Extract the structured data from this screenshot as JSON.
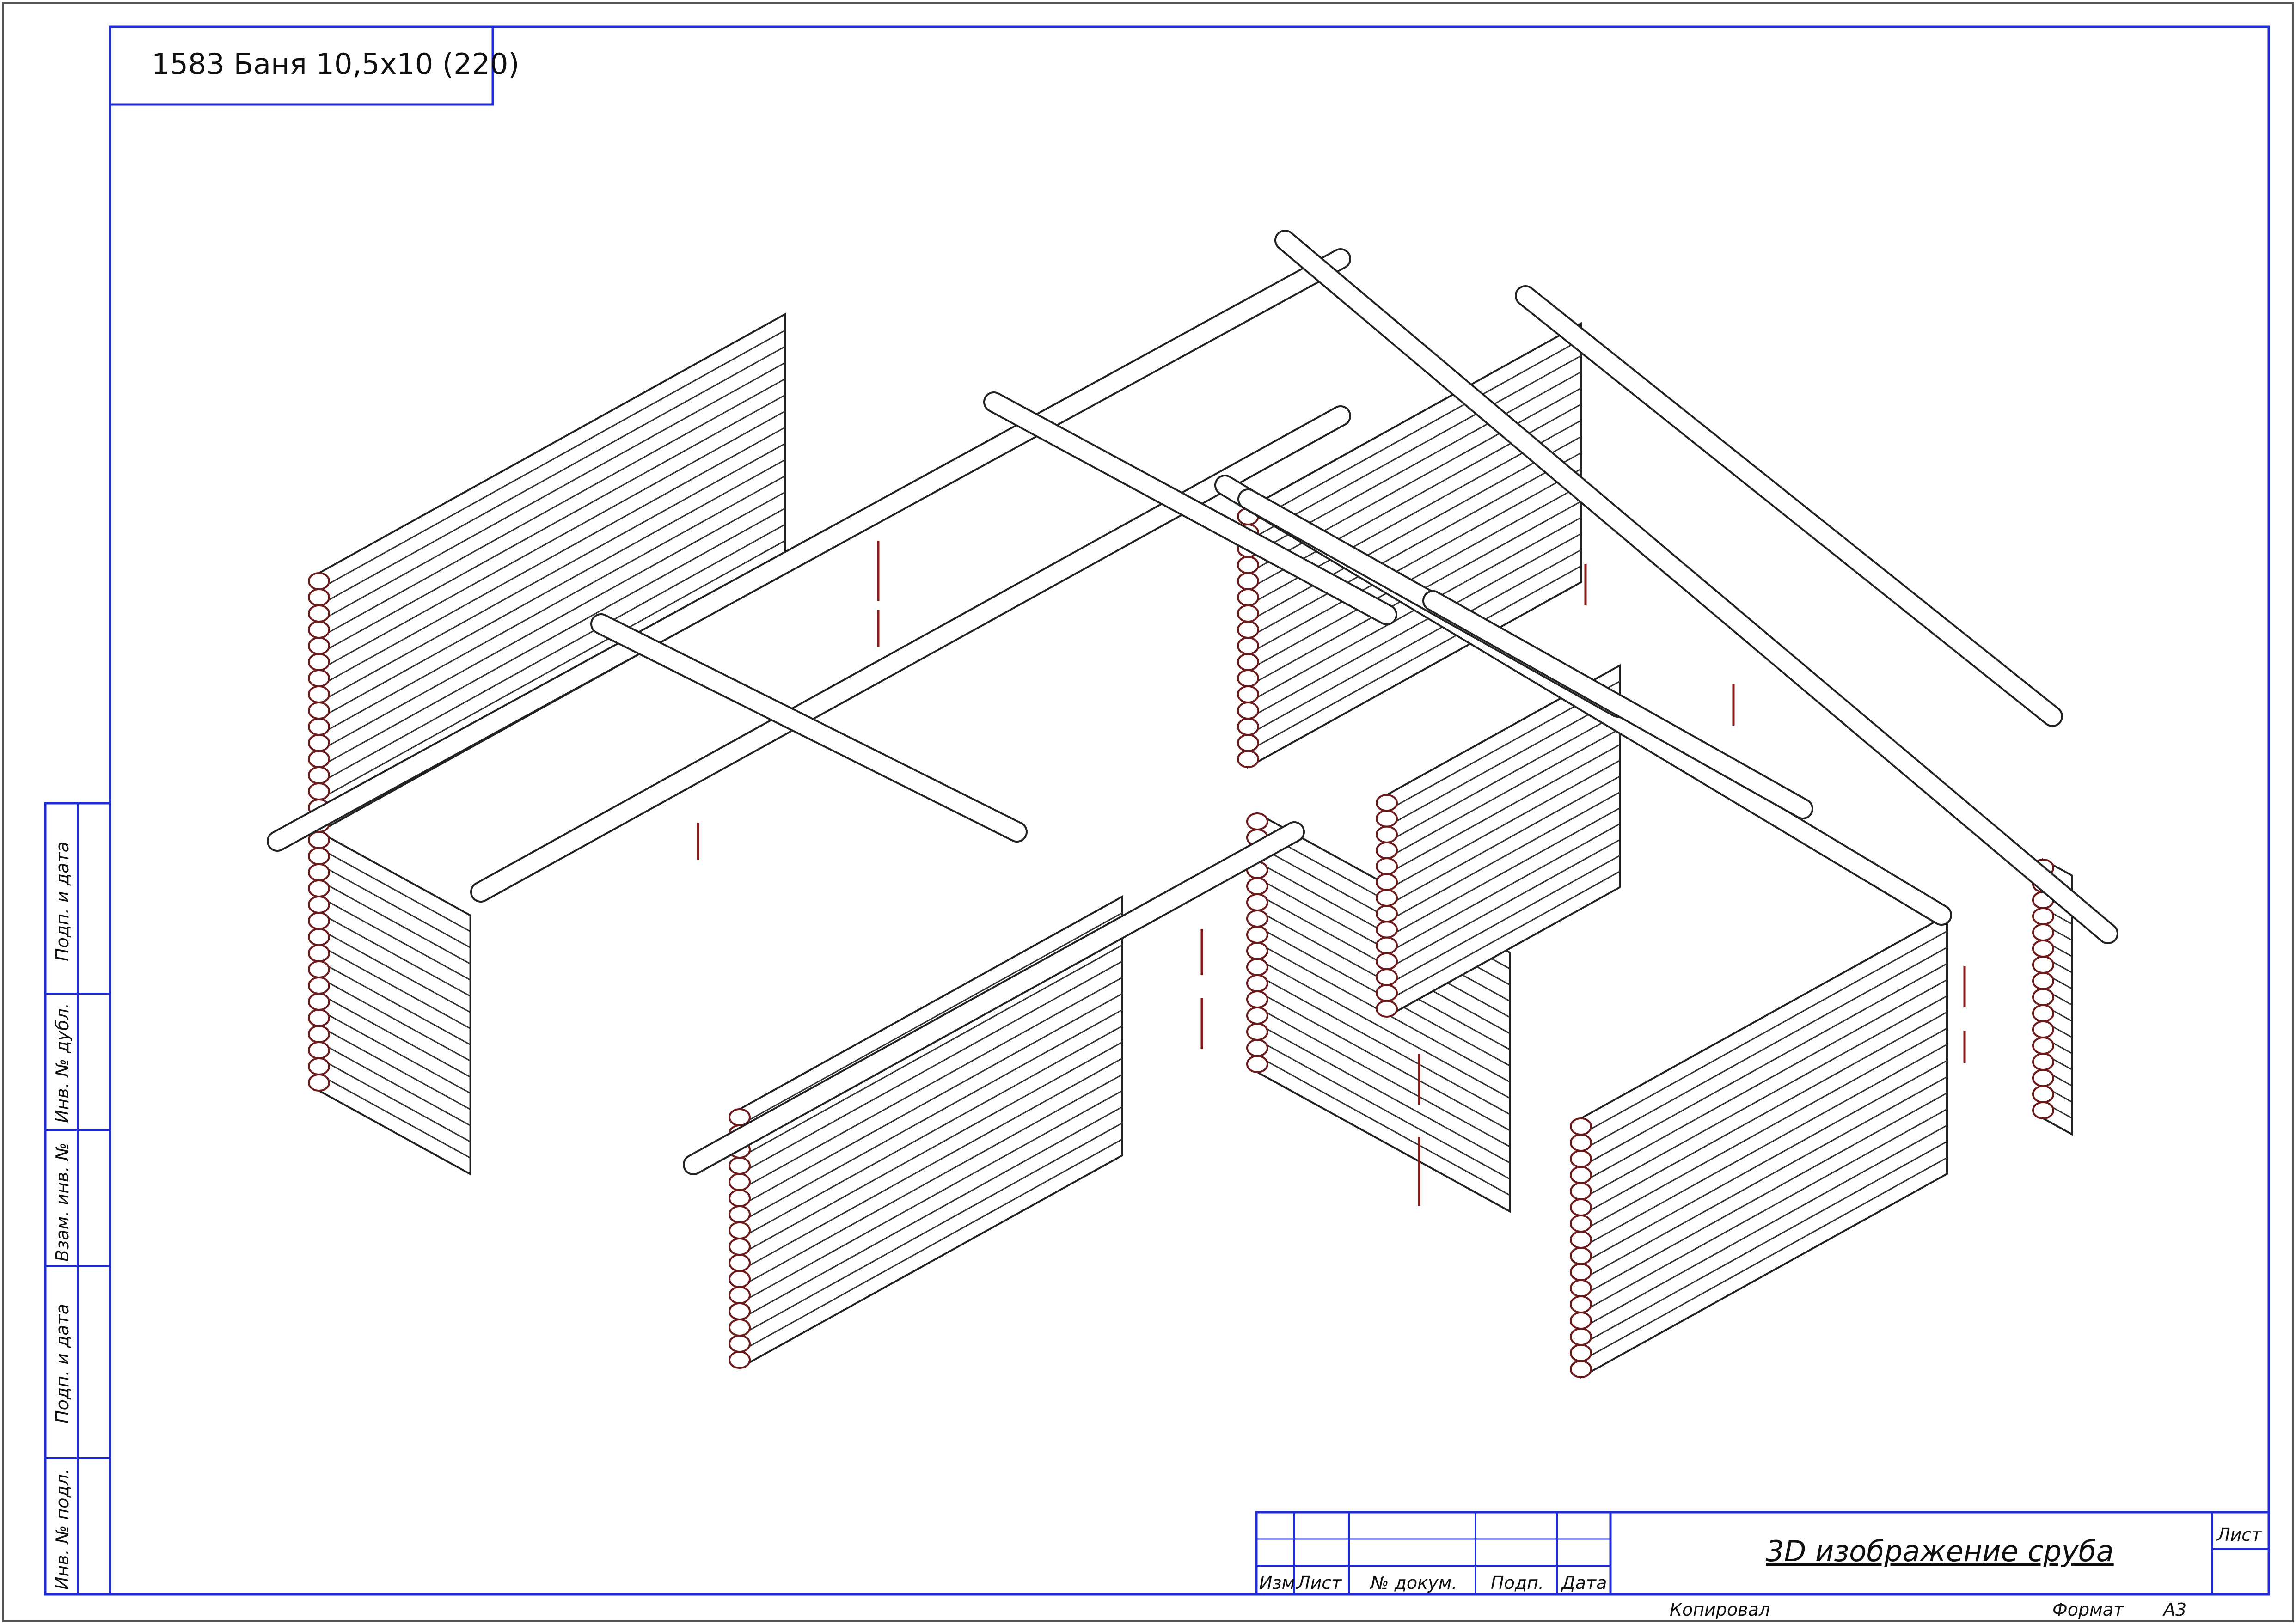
{
  "drawing": {
    "title": "1583 Баня 10,5х10 (220)",
    "sheet_caption": "3D изображение сруба"
  },
  "side_stamp": {
    "labels": [
      "Подп. и дата",
      "Инв. № дубл.",
      "Взам. инв. №",
      "Подп. и дата",
      "Инв. № подл."
    ]
  },
  "title_block": {
    "headers": [
      "Изм.",
      "Лист",
      "№ докум.",
      "Подп.",
      "Дата"
    ],
    "sheet_label": "Лист"
  },
  "footer": {
    "copied": "Копировал",
    "format_label": "Формат",
    "format_value": "А3"
  },
  "colors": {
    "frame": "#1f2bd6",
    "log_ends": "#8b1a1a",
    "ink": "#101010"
  },
  "illustration": {
    "name": "isometric log frame (сруб) model",
    "style": "wireframe line drawing"
  }
}
